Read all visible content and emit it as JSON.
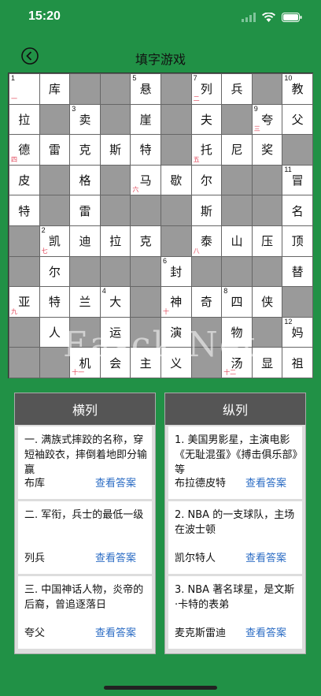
{
  "status": {
    "time": "15:20"
  },
  "nav": {
    "title": "填字游戏"
  },
  "grid": [
    [
      {
        "n": "1",
        "m": "一"
      },
      {
        "c": "库"
      },
      {
        "b": 1
      },
      {
        "b": 1
      },
      {
        "n": "5",
        "c": "悬"
      },
      {
        "b": 1
      },
      {
        "n": "7",
        "c": "列",
        "m": "二"
      },
      {
        "c": "兵"
      },
      {
        "b": 1
      },
      {
        "n": "10",
        "c": "教"
      }
    ],
    [
      {
        "c": "拉"
      },
      {
        "b": 1
      },
      {
        "n": "3",
        "c": "卖"
      },
      {
        "b": 1
      },
      {
        "c": "崖"
      },
      {
        "b": 1
      },
      {
        "c": "夫"
      },
      {
        "b": 1
      },
      {
        "n": "9",
        "c": "夸",
        "m": "三"
      },
      {
        "c": "父"
      }
    ],
    [
      {
        "c": "德",
        "m": "四"
      },
      {
        "c": "雷"
      },
      {
        "c": "克"
      },
      {
        "c": "斯"
      },
      {
        "c": "特"
      },
      {
        "b": 1
      },
      {
        "c": "托",
        "m": "五"
      },
      {
        "c": "尼"
      },
      {
        "c": "奖"
      },
      {
        "b": 1
      }
    ],
    [
      {
        "c": "皮"
      },
      {
        "b": 1
      },
      {
        "c": "格"
      },
      {
        "b": 1
      },
      {
        "c": "马",
        "m": "六"
      },
      {
        "c": "歇"
      },
      {
        "c": "尔"
      },
      {
        "b": 1
      },
      {
        "b": 1
      },
      {
        "n": "11",
        "c": "冒"
      }
    ],
    [
      {
        "c": "特"
      },
      {
        "b": 1
      },
      {
        "c": "雷"
      },
      {
        "b": 1
      },
      {
        "b": 1
      },
      {
        "b": 1
      },
      {
        "c": "斯"
      },
      {
        "b": 1
      },
      {
        "b": 1
      },
      {
        "c": "名"
      }
    ],
    [
      {
        "b": 1
      },
      {
        "n": "2",
        "c": "凯",
        "m": "七"
      },
      {
        "c": "迪"
      },
      {
        "c": "拉"
      },
      {
        "c": "克"
      },
      {
        "b": 1
      },
      {
        "c": "泰",
        "m": "八"
      },
      {
        "c": "山"
      },
      {
        "c": "压"
      },
      {
        "c": "顶"
      }
    ],
    [
      {
        "b": 1
      },
      {
        "c": "尔"
      },
      {
        "b": 1
      },
      {
        "b": 1
      },
      {
        "b": 1
      },
      {
        "n": "6",
        "c": "封"
      },
      {
        "b": 1
      },
      {
        "b": 1
      },
      {
        "b": 1
      },
      {
        "c": "替"
      }
    ],
    [
      {
        "c": "亚",
        "m": "九"
      },
      {
        "c": "特"
      },
      {
        "c": "兰"
      },
      {
        "n": "4",
        "c": "大"
      },
      {
        "b": 1
      },
      {
        "c": "神",
        "m": "十"
      },
      {
        "c": "奇"
      },
      {
        "n": "8",
        "c": "四"
      },
      {
        "c": "侠"
      },
      {
        "b": 1
      }
    ],
    [
      {
        "b": 1
      },
      {
        "c": "人"
      },
      {
        "b": 1
      },
      {
        "c": "运"
      },
      {
        "b": 1
      },
      {
        "c": "演"
      },
      {
        "b": 1
      },
      {
        "c": "物"
      },
      {
        "b": 1
      },
      {
        "n": "12",
        "c": "妈"
      }
    ],
    [
      {
        "b": 1
      },
      {
        "b": 1
      },
      {
        "c": "机",
        "m": "十一"
      },
      {
        "c": "会"
      },
      {
        "c": "主"
      },
      {
        "c": "义"
      },
      {
        "b": 1
      },
      {
        "c": "汤",
        "m": "十二"
      },
      {
        "c": "显"
      },
      {
        "c": "祖"
      }
    ]
  ],
  "across": {
    "header": "横列",
    "clues": [
      {
        "text": "一. 满族式摔跤的名称，穿短袖跤衣，摔倒着地即分输赢",
        "answer": "布库",
        "link": "查看答案"
      },
      {
        "text": "二. 军衔，兵士的最低一级",
        "answer": "列兵",
        "link": "查看答案"
      },
      {
        "text": "三. 中国神话人物，炎帝的后裔，曾追逐落日",
        "answer": "夸父",
        "link": "查看答案"
      }
    ]
  },
  "down": {
    "header": "纵列",
    "clues": [
      {
        "text": "1. 美国男影星，主演电影《无耻混蛋》《搏击俱乐部》等",
        "answer": "布拉德皮特",
        "link": "查看答案"
      },
      {
        "text": "2. NBA 的一支球队，主场在波士顿",
        "answer": "凯尔特人",
        "link": "查看答案"
      },
      {
        "text": "3. NBA 著名球星，是文斯·卡特的表弟",
        "answer": "麦克斯雷迪",
        "link": "查看答案"
      }
    ]
  },
  "watermark": "Easck.Net"
}
